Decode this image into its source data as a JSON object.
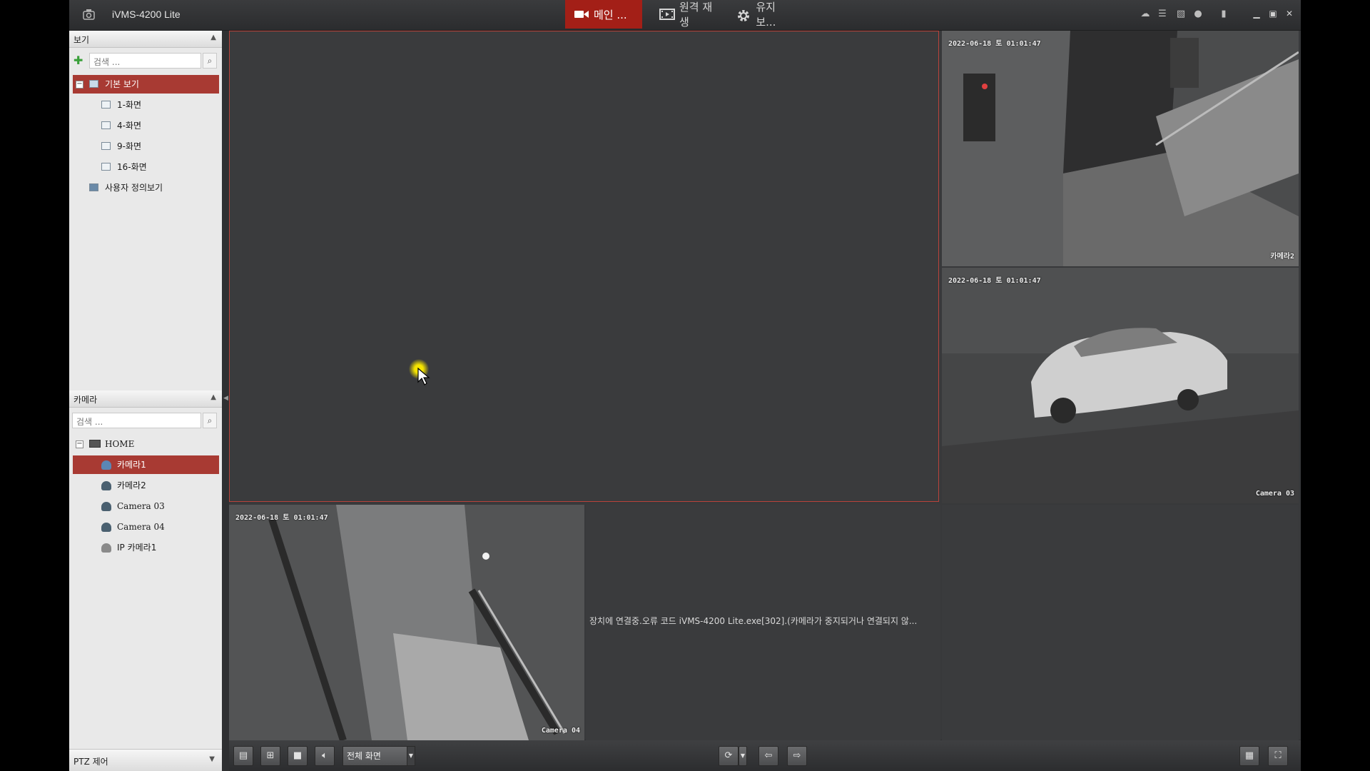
{
  "app": {
    "title": "iVMS-4200 Lite"
  },
  "topnav": {
    "main": "메인 ...",
    "remote": "원격 재생",
    "maintenance": "유지 보..."
  },
  "view_panel": {
    "title": "보기",
    "search_placeholder": "검색 ...",
    "group": "기본 보기",
    "items": [
      "1-화면",
      "4-화면",
      "9-화면",
      "16-화면"
    ],
    "custom": "사용자 정의보기"
  },
  "camera_panel": {
    "title": "카메라",
    "search_placeholder": "검색 ...",
    "root": "HOME",
    "cameras": [
      "카메라1",
      "카메라2",
      "Camera 03",
      "Camera 04",
      "IP 카메라1"
    ],
    "selected": "카메라1"
  },
  "ptz": {
    "label": "PTZ 제어"
  },
  "tiles": {
    "t2": {
      "timestamp": "2022-06-18 토 01:01:47",
      "label": "카메라2"
    },
    "t3": {
      "timestamp": "2022-06-18 토 01:01:47",
      "label": "Camera 03"
    },
    "t4": {
      "timestamp": "2022-06-18 토 01:01:47",
      "label": "Camera 04"
    },
    "t5": {
      "message": "장치에 연결중.오류 코드 iVMS-4200 Lite.exe[302].(카메라가 중지되거나 연결되지 않..."
    }
  },
  "bottombar": {
    "fullscreen_mode": "전체 화면"
  },
  "colors": {
    "accent": "#a31f17",
    "selected_row": "#a83a33",
    "active_tile_border": "#b9433b"
  }
}
